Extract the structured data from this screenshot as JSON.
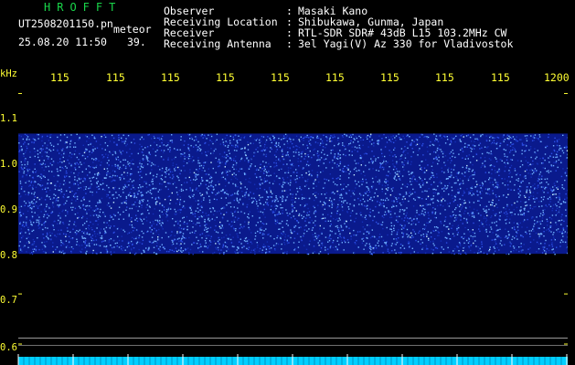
{
  "header": {
    "app_name": "HROFFT",
    "filename": "UT2508201150.pn",
    "mode": "meteor",
    "date_time": "25.08.20 11:50",
    "count": "39.",
    "fields": [
      {
        "label": "Observer",
        "value": "Masaki Kano"
      },
      {
        "label": "Receiving Location",
        "value": "Shibukawa, Gunma, Japan"
      },
      {
        "label": "Receiver",
        "value": "RTL-SDR SDR# 43dB L15 103.2MHz CW"
      },
      {
        "label": "Receiving Antenna",
        "value": "3el Yagi(V) Az 330 for Vladivostok"
      }
    ]
  },
  "axes": {
    "y_unit": "kHz",
    "y_ticks": [
      "1.1",
      "1.0",
      "0.9",
      "0.8",
      "0.7",
      "0.6"
    ],
    "y_values": [
      1.1,
      1.0,
      0.9,
      0.8,
      0.7,
      0.6
    ],
    "x_ticks": [
      "115",
      "115",
      "115",
      "115",
      "115",
      "115",
      "115",
      "115",
      "115",
      "1200"
    ],
    "y_range": [
      0.58,
      1.15
    ]
  },
  "spectrogram": {
    "band_low_khz": 0.78,
    "band_high_khz": 1.02,
    "colors": {
      "background": "#000000",
      "noise_dark": "#0a1a8c",
      "noise_mid": "#2c4fe6",
      "noise_bright": "#6fb0ff",
      "highlight": "#c8f0ff",
      "grid": "#3a3a3a",
      "tick_text": "#ffff33",
      "ruler": "#00cfff"
    }
  }
}
